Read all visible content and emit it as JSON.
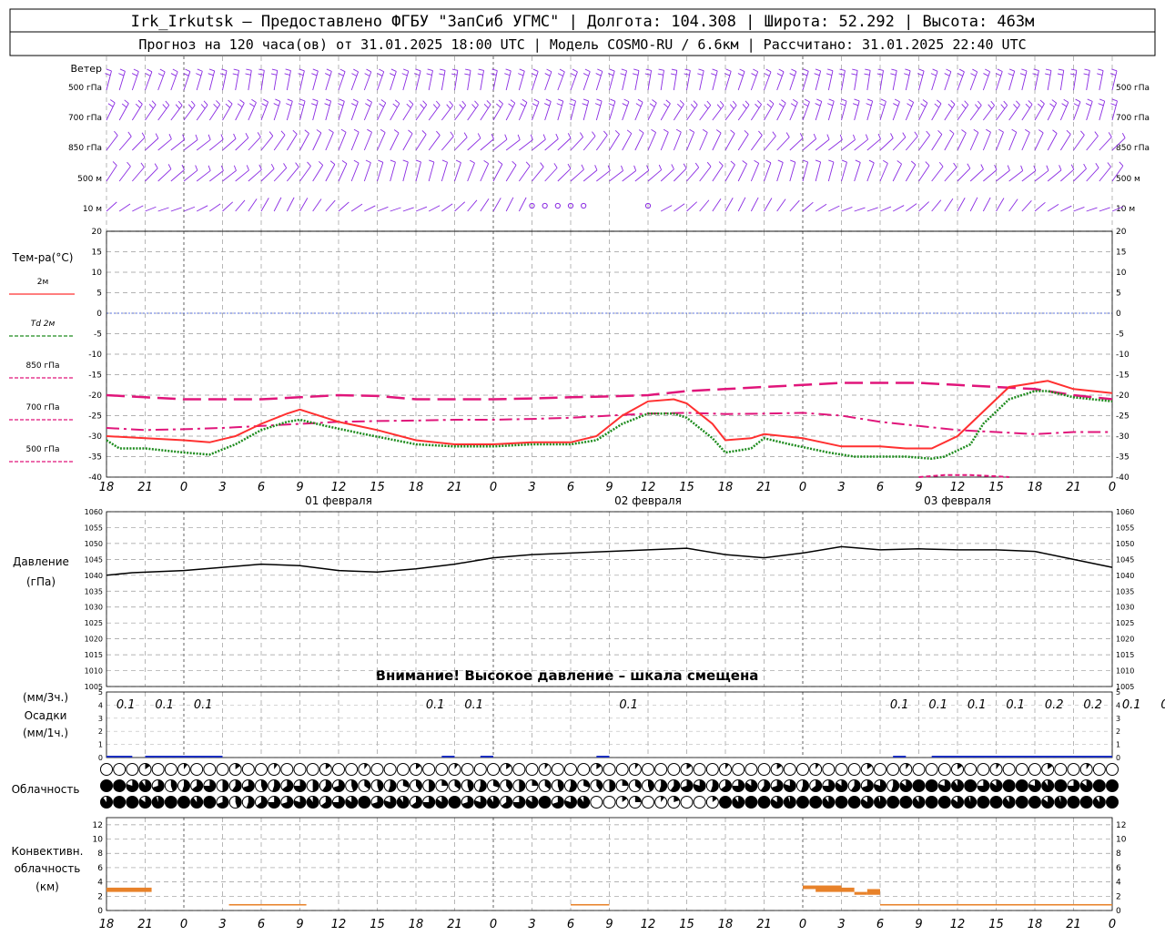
{
  "header": {
    "line1": "Irk_Irkutsk – Предоставлено ФГБУ \"ЗапСиб УГМС\" | Долгота: 104.308 | Широта: 52.292 | Высота: 463м",
    "line2": "Прогноз на 120 часа(ов) от 31.01.2025 18:00 UTC  | Модель COSMO-RU / 6.6км | Рассчитано: 31.01.2025 22:40 UTC"
  },
  "time_axis": {
    "tick_labels": [
      "18",
      "21",
      "0",
      "3",
      "6",
      "9",
      "12",
      "15",
      "18",
      "21",
      "0",
      "3",
      "6",
      "9",
      "12",
      "15",
      "18",
      "21",
      "0",
      "3",
      "6",
      "9",
      "12",
      "15",
      "18",
      "21",
      "0"
    ],
    "day_labels": [
      "01 февраля",
      "02 февраля",
      "03 февраля"
    ]
  },
  "wind_panel": {
    "title": "Ветер",
    "levels": [
      "500 гПа",
      "700 гПа",
      "850 гПа",
      "500 м",
      "10  м"
    ],
    "color": "#8a2be2"
  },
  "temp_panel": {
    "title": "Тем-ра(°C)",
    "legend": [
      {
        "label": "2м",
        "color": "#ff3030",
        "style": "solid"
      },
      {
        "label": "Td 2м",
        "color": "#1e8c1e",
        "style": "dotted"
      },
      {
        "label": "850 гПа",
        "color": "#e0157a",
        "style": "dashdot"
      },
      {
        "label": "700 гПа",
        "color": "#e0157a",
        "style": "dashed"
      },
      {
        "label": "500 гПа",
        "color": "#e0157a",
        "style": "shortdash"
      }
    ],
    "yticks": [
      "20",
      "15",
      "10",
      "5",
      "0",
      "-5",
      "-10",
      "-15",
      "-20",
      "-25",
      "-30",
      "-35",
      "-40"
    ]
  },
  "pressure_panel": {
    "title_1": "Давление",
    "title_2": "(гПа)",
    "yticks": [
      "1060",
      "1055",
      "1050",
      "1045",
      "1040",
      "1035",
      "1030",
      "1025",
      "1020",
      "1015",
      "1010",
      "1005"
    ],
    "warning": "Внимание! Высокое давление – шкала смещена"
  },
  "precip_panel": {
    "unit_3h": "(мм/3ч.)",
    "title": "Осадки",
    "unit_1h": "(мм/1ч.)",
    "yticks": [
      "5",
      "4",
      "3",
      "2",
      "1",
      "0"
    ],
    "amounts": [
      {
        "hour": 3,
        "value": "0.1"
      },
      {
        "hour": 6,
        "value": "0.1"
      },
      {
        "hour": 9,
        "value": "0.1"
      },
      {
        "hour": 27,
        "value": "0.1"
      },
      {
        "hour": 30,
        "value": "0.1"
      },
      {
        "hour": 42,
        "value": "0.1"
      },
      {
        "hour": 63,
        "value": "0.1"
      },
      {
        "hour": 66,
        "value": "0.1"
      },
      {
        "hour": 69,
        "value": "0.1"
      },
      {
        "hour": 72,
        "value": "0.1"
      },
      {
        "hour": 75,
        "value": "0.2"
      },
      {
        "hour": 78,
        "value": "0.2"
      },
      {
        "hour": 81,
        "value": "0.1"
      },
      {
        "hour": 84,
        "value": "0.1"
      }
    ]
  },
  "cloud_panel": {
    "title": "Облачность"
  },
  "conv_panel": {
    "title_1": "Конвективн.",
    "title_2": "облачность",
    "title_3": "(км)",
    "yticks": [
      "12",
      "10",
      "8",
      "6",
      "4",
      "2",
      "0"
    ]
  },
  "chart_data": [
    {
      "type": "line",
      "title": "Тем-ра(°C)",
      "x_unit": "hours since 31.01.2025 18:00 UTC",
      "ylim": [
        -40,
        20
      ],
      "xlim": [
        0,
        78
      ],
      "series": [
        {
          "name": "2м",
          "points": [
            [
              0,
              -30
            ],
            [
              3,
              -30.5
            ],
            [
              6,
              -31
            ],
            [
              8,
              -31.5
            ],
            [
              10,
              -30
            ],
            [
              12,
              -27
            ],
            [
              14,
              -24.5
            ],
            [
              15,
              -23.5
            ],
            [
              16,
              -24.5
            ],
            [
              18,
              -26.5
            ],
            [
              21,
              -28.5
            ],
            [
              24,
              -31
            ],
            [
              27,
              -32
            ],
            [
              30,
              -32
            ],
            [
              33,
              -31.5
            ],
            [
              36,
              -31.5
            ],
            [
              38,
              -30
            ],
            [
              40,
              -25
            ],
            [
              42,
              -21.5
            ],
            [
              44,
              -21
            ],
            [
              45,
              -22
            ],
            [
              47,
              -27
            ],
            [
              48,
              -31
            ],
            [
              50,
              -30.5
            ],
            [
              51,
              -29.5
            ],
            [
              54,
              -30.5
            ],
            [
              57,
              -32.5
            ],
            [
              60,
              -32.5
            ],
            [
              62,
              -33
            ],
            [
              64,
              -33
            ],
            [
              66,
              -30
            ],
            [
              68,
              -24
            ],
            [
              70,
              -18
            ],
            [
              72,
              -17
            ],
            [
              73,
              -16.5
            ],
            [
              75,
              -18.5
            ],
            [
              78,
              -19.5
            ],
            [
              81,
              -19.5
            ],
            [
              84,
              -20.5
            ],
            [
              87,
              -21.5
            ],
            [
              90,
              -22
            ]
          ]
        },
        {
          "name": "Td 2м",
          "points": [
            [
              0,
              -31
            ],
            [
              1,
              -33
            ],
            [
              3,
              -33
            ],
            [
              6,
              -34
            ],
            [
              8,
              -34.5
            ],
            [
              10,
              -32
            ],
            [
              12,
              -28.5
            ],
            [
              14,
              -26.5
            ],
            [
              15,
              -26
            ],
            [
              17,
              -27.5
            ],
            [
              20,
              -29.5
            ],
            [
              24,
              -32
            ],
            [
              27,
              -32.5
            ],
            [
              30,
              -32.5
            ],
            [
              33,
              -32
            ],
            [
              36,
              -32
            ],
            [
              38,
              -31
            ],
            [
              40,
              -27
            ],
            [
              42,
              -24.5
            ],
            [
              44,
              -24.5
            ],
            [
              45,
              -25.5
            ],
            [
              47,
              -30.5
            ],
            [
              48,
              -34
            ],
            [
              50,
              -33
            ],
            [
              51,
              -30.5
            ],
            [
              53,
              -32
            ],
            [
              56,
              -34
            ],
            [
              58,
              -35
            ],
            [
              62,
              -35
            ],
            [
              64,
              -35.5
            ],
            [
              65,
              -35
            ],
            [
              67,
              -32
            ],
            [
              68,
              -27
            ],
            [
              70,
              -21
            ],
            [
              72,
              -19
            ],
            [
              73,
              -19
            ],
            [
              75,
              -20.5
            ],
            [
              78,
              -21.5
            ],
            [
              81,
              -21.5
            ],
            [
              84,
              -22.5
            ],
            [
              87,
              -23.5
            ],
            [
              90,
              -24.5
            ]
          ]
        },
        {
          "name": "850 гПа",
          "points": [
            [
              0,
              -28
            ],
            [
              3,
              -28.5
            ],
            [
              6,
              -28.3
            ],
            [
              9,
              -28
            ],
            [
              12,
              -27.5
            ],
            [
              15,
              -27
            ],
            [
              18,
              -26.5
            ],
            [
              21,
              -26.3
            ],
            [
              24,
              -26.2
            ],
            [
              27,
              -26
            ],
            [
              30,
              -26
            ],
            [
              33,
              -25.8
            ],
            [
              36,
              -25.5
            ],
            [
              39,
              -25
            ],
            [
              42,
              -24.5
            ],
            [
              45,
              -24.3
            ],
            [
              48,
              -24.6
            ],
            [
              51,
              -24.5
            ],
            [
              54,
              -24.3
            ],
            [
              57,
              -25
            ],
            [
              60,
              -26.5
            ],
            [
              63,
              -27.5
            ],
            [
              66,
              -28.5
            ],
            [
              69,
              -29
            ],
            [
              72,
              -29.5
            ],
            [
              75,
              -29
            ],
            [
              78,
              -29
            ],
            [
              81,
              -29.5
            ],
            [
              84,
              -29
            ],
            [
              87,
              -29
            ],
            [
              90,
              -29
            ]
          ]
        },
        {
          "name": "700 гПа",
          "points": [
            [
              0,
              -20
            ],
            [
              3,
              -20.5
            ],
            [
              6,
              -21
            ],
            [
              9,
              -21
            ],
            [
              12,
              -21
            ],
            [
              15,
              -20.5
            ],
            [
              18,
              -20
            ],
            [
              21,
              -20.2
            ],
            [
              24,
              -21
            ],
            [
              27,
              -21
            ],
            [
              30,
              -21
            ],
            [
              33,
              -20.8
            ],
            [
              36,
              -20.5
            ],
            [
              39,
              -20.3
            ],
            [
              42,
              -20
            ],
            [
              45,
              -19
            ],
            [
              48,
              -18.5
            ],
            [
              51,
              -18
            ],
            [
              54,
              -17.5
            ],
            [
              57,
              -17
            ],
            [
              60,
              -17
            ],
            [
              63,
              -17
            ],
            [
              66,
              -17.5
            ],
            [
              69,
              -18
            ],
            [
              72,
              -18.5
            ],
            [
              75,
              -20
            ],
            [
              78,
              -21
            ],
            [
              81,
              -21.5
            ],
            [
              84,
              -22.5
            ],
            [
              87,
              -23.5
            ],
            [
              90,
              -24.5
            ]
          ]
        },
        {
          "name": "500 гПа",
          "points": [
            [
              63,
              -40
            ],
            [
              65,
              -39.5
            ],
            [
              67,
              -39.5
            ],
            [
              69,
              -39.8
            ],
            [
              70,
              -40
            ]
          ]
        }
      ]
    },
    {
      "type": "line",
      "title": "Давление",
      "ylabel": "(гПа)",
      "ylim": [
        1005,
        1060
      ],
      "xlim": [
        0,
        78
      ],
      "series": [
        {
          "name": "",
          "points": [
            [
              0,
              1040
            ],
            [
              2,
              1040.8
            ],
            [
              6,
              1041.5
            ],
            [
              9,
              1042.5
            ],
            [
              12,
              1043.5
            ],
            [
              15,
              1043
            ],
            [
              18,
              1041.5
            ],
            [
              21,
              1041
            ],
            [
              24,
              1042
            ],
            [
              27,
              1043.5
            ],
            [
              30,
              1045.5
            ],
            [
              33,
              1046.5
            ],
            [
              36,
              1047
            ],
            [
              39,
              1047.5
            ],
            [
              42,
              1048
            ],
            [
              45,
              1048.5
            ],
            [
              48,
              1046.5
            ],
            [
              51,
              1045.5
            ],
            [
              54,
              1047
            ],
            [
              57,
              1049
            ],
            [
              60,
              1048
            ],
            [
              63,
              1048.3
            ],
            [
              66,
              1048
            ],
            [
              69,
              1048
            ],
            [
              72,
              1047.5
            ],
            [
              75,
              1045
            ],
            [
              78,
              1042.5
            ],
            [
              81,
              1042
            ],
            [
              84,
              1043.5
            ],
            [
              87,
              1044.5
            ],
            [
              90,
              1044.5
            ],
            [
              93,
              1044
            ],
            [
              96,
              1043.5
            ]
          ]
        }
      ]
    },
    {
      "type": "bar",
      "title": "Конвективн. облачность (км)",
      "ylim": [
        0,
        13
      ],
      "segments": [
        {
          "start": 0,
          "end": 3.5,
          "top": 3.2,
          "bottom": 2.6
        },
        {
          "start": 9.5,
          "end": 15.5,
          "top": 0.9,
          "bottom": 0.7
        },
        {
          "start": 36,
          "end": 39,
          "top": 0.9,
          "bottom": 0.7
        },
        {
          "start": 54,
          "end": 57,
          "top": 3.5,
          "bottom": 3
        },
        {
          "start": 55,
          "end": 58,
          "top": 3.2,
          "bottom": 2.6
        },
        {
          "start": 58,
          "end": 59,
          "top": 2.6,
          "bottom": 2.2
        },
        {
          "start": 59,
          "end": 60,
          "top": 3,
          "bottom": 2.2
        },
        {
          "start": 60,
          "end": 78,
          "top": 0.9,
          "bottom": 0.7
        }
      ]
    }
  ]
}
